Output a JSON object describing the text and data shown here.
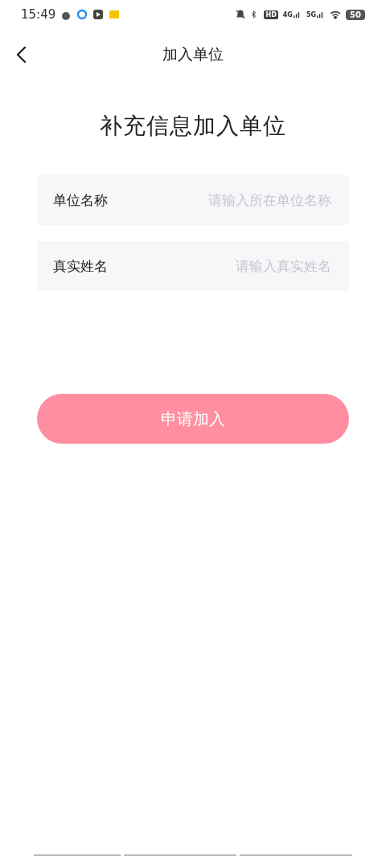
{
  "status_bar": {
    "time": "15:49",
    "network_labels": [
      "HD",
      "4G",
      "5G"
    ],
    "battery": "50"
  },
  "nav": {
    "title": "加入单位"
  },
  "heading": "补充信息加入单位",
  "fields": [
    {
      "label": "单位名称",
      "placeholder": "请输入所在单位名称"
    },
    {
      "label": "真实姓名",
      "placeholder": "请输入真实姓名"
    }
  ],
  "submit_button": {
    "label": "申请加入",
    "disabled": true
  }
}
